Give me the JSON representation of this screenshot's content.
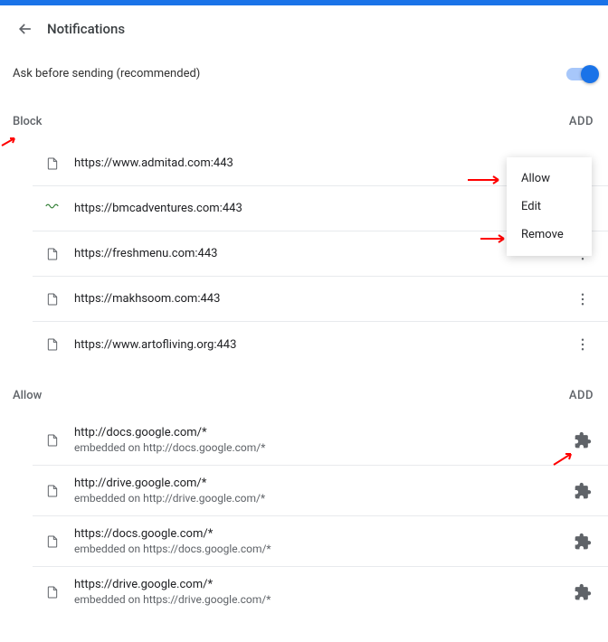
{
  "header": {
    "title": "Notifications"
  },
  "setting": {
    "label": "Ask before sending (recommended)"
  },
  "block": {
    "title": "Block",
    "add": "ADD",
    "items": [
      {
        "url": "https://www.admitad.com:443",
        "icon": "page"
      },
      {
        "url": "https://bmcadventures.com:443",
        "icon": "squiggle"
      },
      {
        "url": "https://freshmenu.com:443",
        "icon": "page"
      },
      {
        "url": "https://makhsoom.com:443",
        "icon": "page"
      },
      {
        "url": "https://www.artofliving.org:443",
        "icon": "page"
      }
    ]
  },
  "allow": {
    "title": "Allow",
    "add": "ADD",
    "items": [
      {
        "url": "http://docs.google.com/*",
        "sub": "embedded on http://docs.google.com/*"
      },
      {
        "url": "http://drive.google.com/*",
        "sub": "embedded on http://drive.google.com/*"
      },
      {
        "url": "https://docs.google.com/*",
        "sub": "embedded on https://docs.google.com/*"
      },
      {
        "url": "https://drive.google.com/*",
        "sub": "embedded on https://drive.google.com/*"
      }
    ]
  },
  "menu": {
    "allow": "Allow",
    "edit": "Edit",
    "remove": "Remove"
  }
}
